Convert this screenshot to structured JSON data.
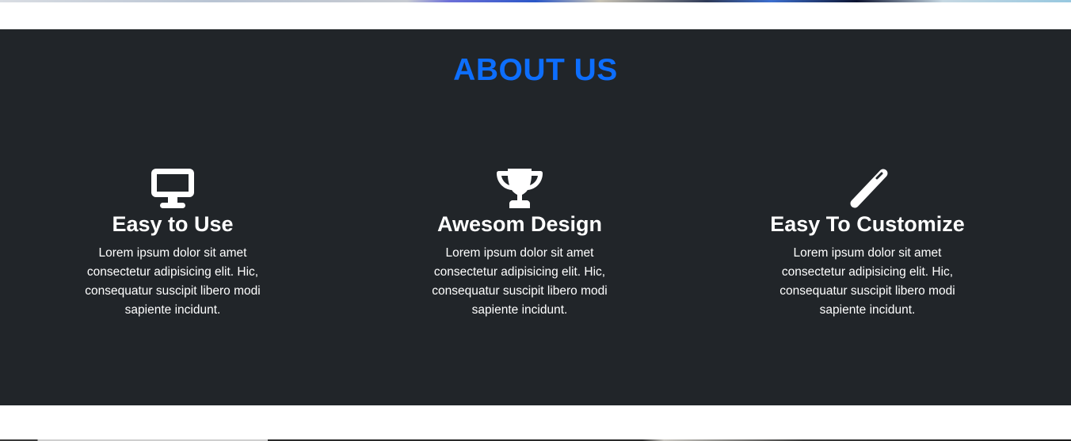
{
  "about": {
    "title": "ABOUT US",
    "title_color": "#0d6efd",
    "background_color": "#212529",
    "features": [
      {
        "icon": "desktop-icon",
        "heading": "Easy to Use",
        "text": "Lorem ipsum dolor sit amet consectetur adipisicing elit. Hic, consequatur suscipit libero modi sapiente incidunt."
      },
      {
        "icon": "trophy-icon",
        "heading": "Awesom Design",
        "text": "Lorem ipsum dolor sit amet consectetur adipisicing elit. Hic, consequatur suscipit libero modi sapiente incidunt."
      },
      {
        "icon": "magic-wand-icon",
        "heading": "Easy To Customize",
        "text": "Lorem ipsum dolor sit amet consectetur adipisicing elit. Hic, consequatur suscipit libero modi sapiente incidunt."
      }
    ]
  }
}
